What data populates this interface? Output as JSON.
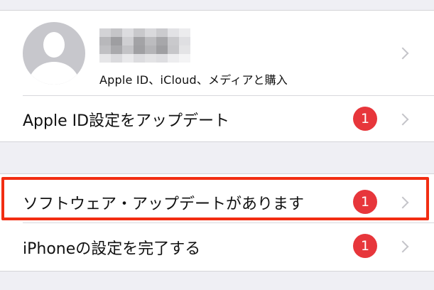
{
  "account": {
    "name_blurred": "",
    "subtitle": "Apple ID、iCloud、メディアと購入"
  },
  "rows": [
    {
      "label": "Apple ID設定をアップデート",
      "badge": "1"
    },
    {
      "label": "ソフトウェア・アップデートがあります",
      "badge": "1"
    },
    {
      "label": "iPhoneの設定を完了する",
      "badge": "1"
    }
  ],
  "colors": {
    "badge": "#e7363b",
    "highlight": "#f22d12",
    "background": "#efeff4"
  }
}
